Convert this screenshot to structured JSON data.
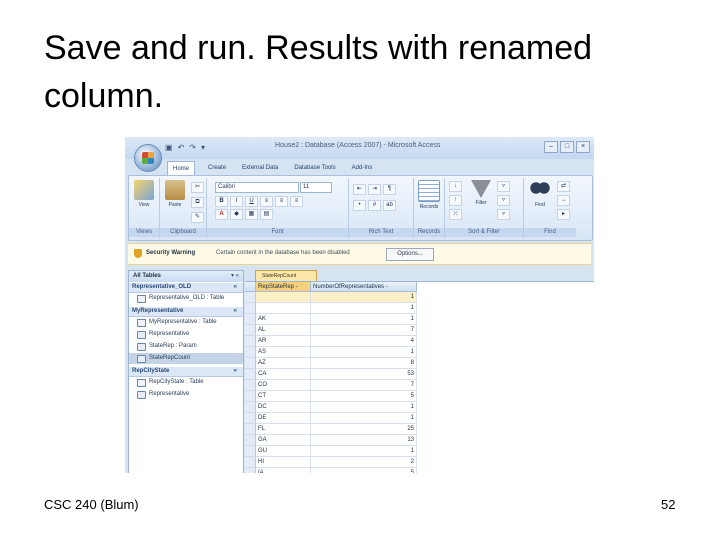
{
  "slide": {
    "title": "Save and run. Results with renamed column.",
    "footer_left": "CSC 240 (Blum)",
    "page_number": "52"
  },
  "window": {
    "title": "House2 : Database (Access 2007) - Microsoft Access",
    "controls": [
      "–",
      "□",
      "×"
    ],
    "qat_icons": [
      "save-icon",
      "undo-icon",
      "redo-icon",
      "dropdown-icon"
    ]
  },
  "ribbon": {
    "tabs": [
      "Home",
      "Create",
      "External Data",
      "Database Tools",
      "Add-Ins"
    ],
    "active_tab": "Home",
    "groups": {
      "views": {
        "label": "Views",
        "view_button": "View"
      },
      "clipboard": {
        "label": "Clipboard",
        "paste_button": "Paste"
      },
      "font": {
        "label": "Font",
        "font_name": "Calibri",
        "font_size": "11"
      },
      "rich_text": {
        "label": "Rich Text"
      },
      "records": {
        "label": "Records",
        "records_button": "Records"
      },
      "sort_filter": {
        "label": "Sort & Filter",
        "filter_button": "Filter"
      },
      "find": {
        "label": "Find",
        "find_button": "Find"
      }
    }
  },
  "security_bar": {
    "title": "Security Warning",
    "message": "Certain content in the database has been disabled",
    "options_button": "Options..."
  },
  "nav_pane": {
    "header": "All Tables",
    "header_controls": "▾  «",
    "groups": [
      {
        "name": "Representative_OLD",
        "items": [
          "Representative_OLD : Table"
        ]
      },
      {
        "name": "MyRepresentative",
        "items": [
          "MyRepresentative : Table",
          "Representative",
          "StateRep : Param",
          "StateRepCount"
        ]
      },
      {
        "name": "RepCityState",
        "items": [
          "RepCityState : Table",
          "Representative"
        ]
      }
    ],
    "selected_item": "StateRepCount"
  },
  "datasheet": {
    "document_tab": "StateRepCount",
    "columns": [
      "RepStateRep -",
      "NumberOfRepresentatives -"
    ],
    "rows": [
      [
        "",
        "1"
      ],
      [
        "",
        "1"
      ],
      [
        "AK",
        "1"
      ],
      [
        "AL",
        "7"
      ],
      [
        "AR",
        "4"
      ],
      [
        "AS",
        "1"
      ],
      [
        "AZ",
        "8"
      ],
      [
        "CA",
        "53"
      ],
      [
        "CO",
        "7"
      ],
      [
        "CT",
        "5"
      ],
      [
        "DC",
        "1"
      ],
      [
        "DE",
        "1"
      ],
      [
        "FL",
        "25"
      ],
      [
        "GA",
        "13"
      ],
      [
        "GU",
        "1"
      ],
      [
        "HI",
        "2"
      ],
      [
        "IA",
        "5"
      ]
    ]
  }
}
